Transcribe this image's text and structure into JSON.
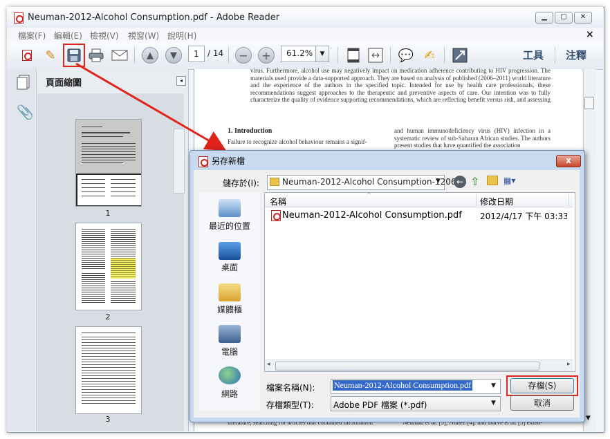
{
  "window": {
    "title": "Neuman-2012-Alcohol Consumption.pdf - Adobe Reader",
    "close_x": "×"
  },
  "menu": [
    "檔案(F)",
    "編輯(E)",
    "檢視(V)",
    "視窗(W)",
    "說明(H)"
  ],
  "toolbar": {
    "page_current": "1",
    "page_total": "/ 14",
    "zoom": "61.2%",
    "tools": "工具",
    "comment": "注釋"
  },
  "sidebar": {
    "title": "頁面縮圖",
    "thumbnails": [
      "1",
      "2",
      "3"
    ]
  },
  "document": {
    "abstract_tail": "virus. Furthermore, alcohol use may negatively impact on medication adherence contributing to HIV progression. The materials used provide a data-supported approach. They are based on analysis of published (2006–2011) world literature and the experience of the authors in the specified topic. Intended for use by health care professionals, these recommendations suggest approaches to the therapeutic and preventive aspects of care. Our intention was to fully characterize the quality of evidence supporting recommendations, which are reflecting benefit versus risk, and assessing strength or certainty.",
    "heading": "1. Introduction",
    "left_col": "Failure to recognize alcohol behaviour remains a signif-",
    "right_col": "and human immunodeficiency virus (HIV) infection in a systematic review of sub-Saharan African studies. The authors present studies that have quantified the association",
    "bottom_left": "literature, searching for articles that contained information",
    "bottom_right": "Neuman et al. [3], Núñez [4], and Barve et al. [5] exten-"
  },
  "dialog": {
    "title": "另存新檔",
    "close": "x",
    "save_in_label": "儲存於(I):",
    "save_in_value": "Neuman-2012-Alcohol Consumption-120656",
    "places": [
      "最近的位置",
      "桌面",
      "媒體櫃",
      "電腦",
      "網路"
    ],
    "columns": [
      "名稱",
      "修改日期"
    ],
    "files": [
      {
        "name": "Neuman-2012-Alcohol Consumption.pdf",
        "date": "2012/4/17 下午 03:33"
      }
    ],
    "filename_label": "檔案名稱(N):",
    "filename_value": "Neuman-2012-Alcohol Consumption.pdf",
    "filetype_label": "存檔類型(T):",
    "filetype_value": "Adobe PDF 檔案 (*.pdf)",
    "save_button": "存檔(S)",
    "cancel_button": "取消"
  },
  "colors": {
    "highlight": "#e0231b",
    "selection": "#3569c8"
  }
}
